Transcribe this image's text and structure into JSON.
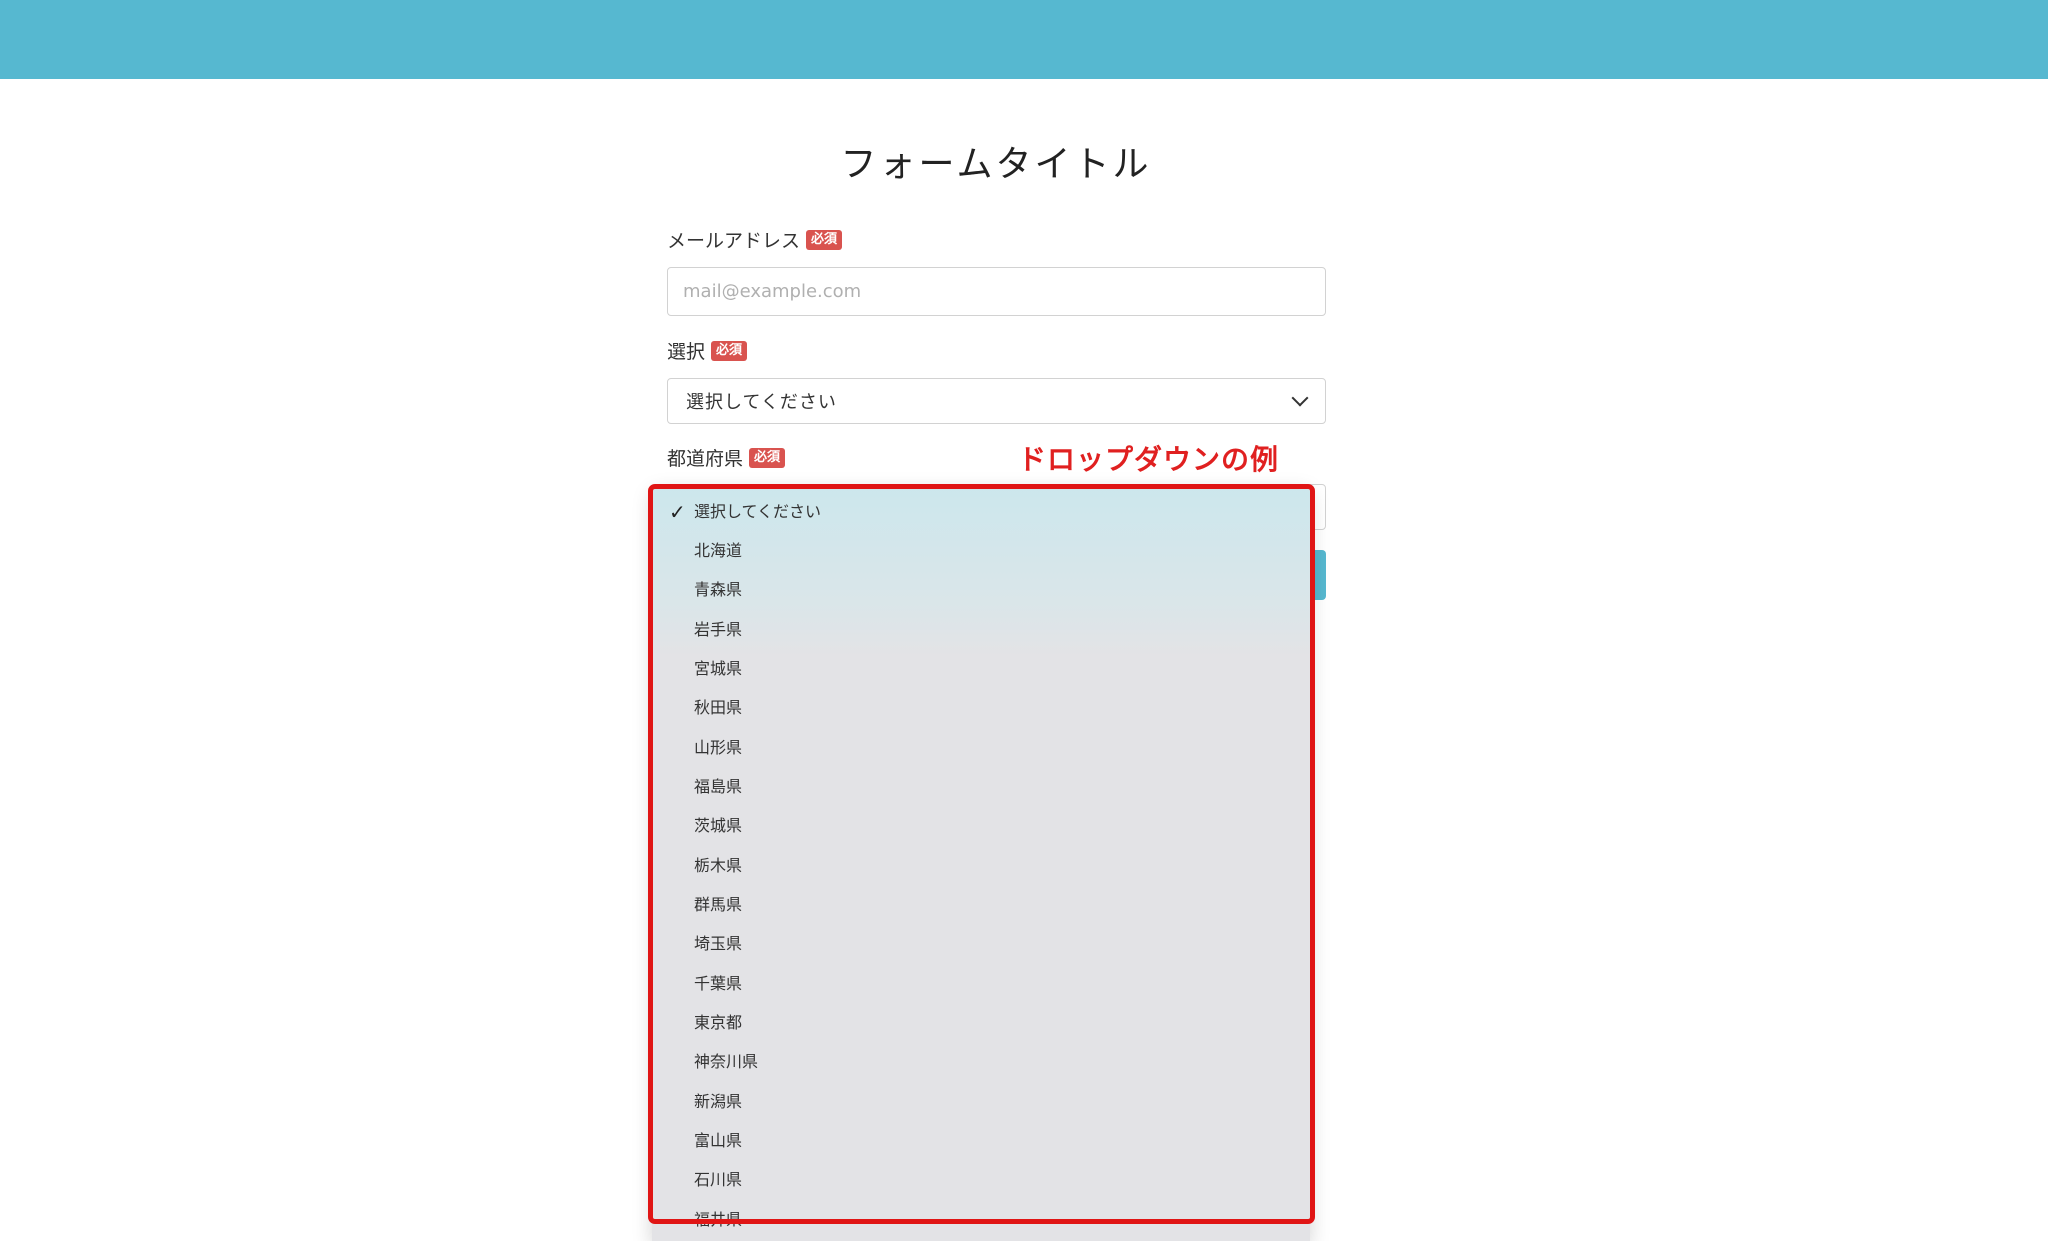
{
  "header": {
    "color": "#56b8d0"
  },
  "form": {
    "title": "フォームタイトル",
    "required_badge": "必須",
    "email": {
      "label": "メールアドレス",
      "placeholder": "mail@example.com"
    },
    "choice": {
      "label": "選択",
      "value": "選択してください"
    },
    "prefecture": {
      "label": "都道府県"
    }
  },
  "annotation": {
    "text": "ドロップダウンの例",
    "color": "#e01515"
  },
  "dropdown": {
    "selected": "選択してください",
    "options": [
      "選択してください",
      "北海道",
      "青森県",
      "岩手県",
      "宮城県",
      "秋田県",
      "山形県",
      "福島県",
      "茨城県",
      "栃木県",
      "群馬県",
      "埼玉県",
      "千葉県",
      "東京都",
      "神奈川県",
      "新潟県",
      "富山県",
      "石川県",
      "福井県"
    ]
  }
}
